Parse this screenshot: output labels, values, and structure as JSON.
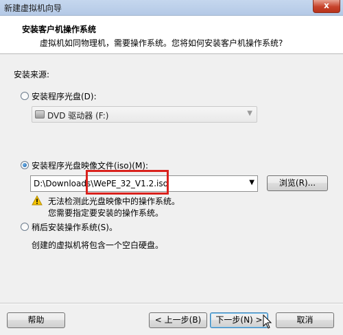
{
  "window": {
    "title": "新建虚拟机向导",
    "close_label": "x"
  },
  "header": {
    "title": "安装客户机操作系统",
    "subtitle": "虚拟机如同物理机，需要操作系统。您将如何安装客户机操作系统?"
  },
  "install_source": {
    "label": "安装来源:",
    "options": [
      {
        "label": "安装程序光盘(D):",
        "selected": false
      },
      {
        "label": "安装程序光盘映像文件(iso)(M):",
        "selected": true
      },
      {
        "label": "稍后安装操作系统(S)。",
        "selected": false
      }
    ],
    "disc_drive": {
      "value": "DVD 驱动器 (F:)",
      "enabled": false
    },
    "iso": {
      "path_prefix": "D:\\Downloads\\",
      "filename": "WePE_32_V1.2.iso",
      "browse_label": "浏览(R)..."
    },
    "warning_line1": "无法检测此光盘映像中的操作系统。",
    "warning_line2": "您需要指定要安装的操作系统。",
    "later_description": "创建的虚拟机将包含一个空白硬盘。"
  },
  "footer": {
    "help_label": "帮助",
    "back_label": "< 上一步(B)",
    "next_label": "下一步(N) >",
    "cancel_label": "取消"
  },
  "colors": {
    "highlight": "#d9211c",
    "warning": "#f5c400"
  }
}
